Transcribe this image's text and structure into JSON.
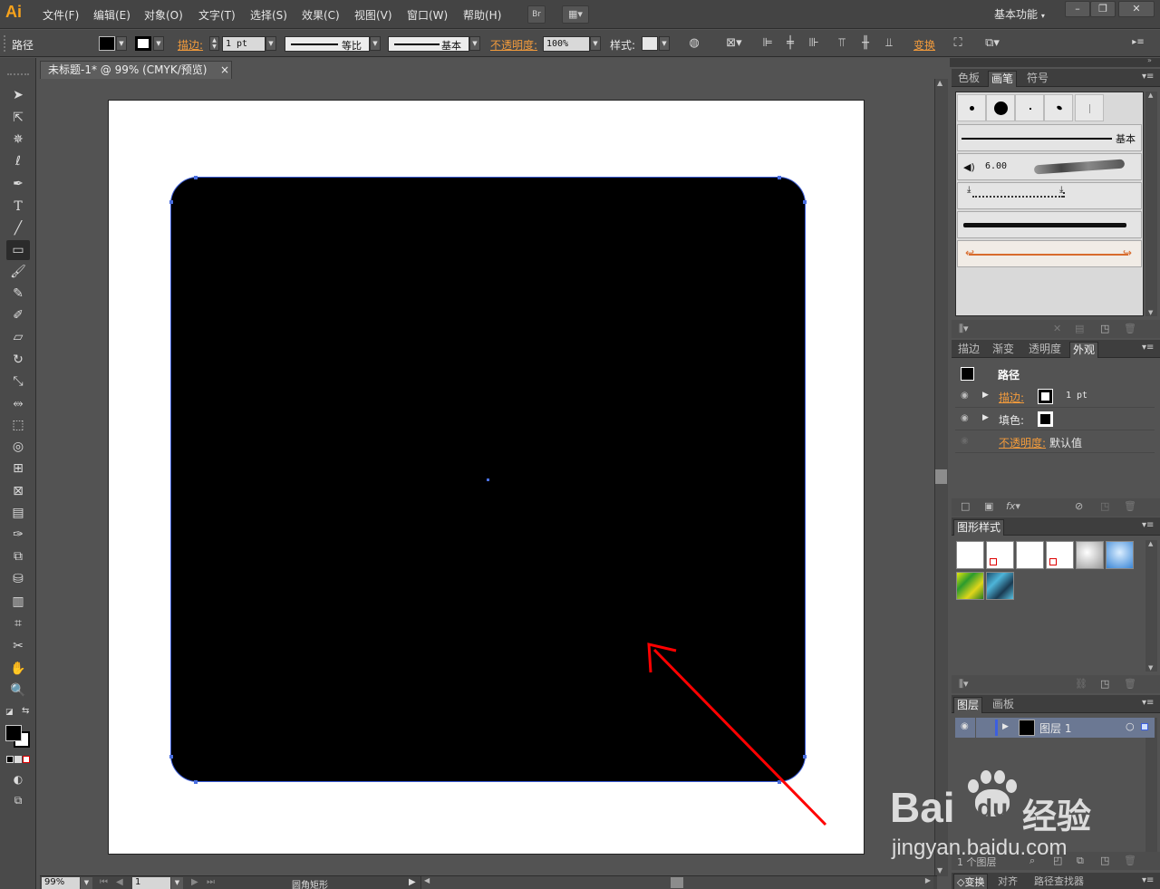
{
  "app": {
    "logo": "Ai",
    "menu": [
      "文件(F)",
      "编辑(E)",
      "对象(O)",
      "文字(T)",
      "选择(S)",
      "效果(C)",
      "视图(V)",
      "窗口(W)",
      "帮助(H)"
    ],
    "bridge_label": "Br",
    "workspace": "基本功能",
    "window_controls": [
      "–",
      "❐",
      "✕"
    ]
  },
  "control": {
    "object_type": "路径",
    "stroke_label": "描边:",
    "stroke_weight": "1 pt",
    "variable_width": "等比",
    "brush_def": "基本",
    "opacity_label": "不透明度:",
    "opacity_value": "100%",
    "style_label": "样式:",
    "transform_label": "变换"
  },
  "document": {
    "tab_title": "未标题-1* @ 99% (CMYK/预览)",
    "tab_close": "×",
    "fill_color": "#000000",
    "path_color": "#3b5cd6",
    "annotation_color": "#ff0000"
  },
  "status": {
    "zoom": "99%",
    "artboard_num": "1",
    "current_tool": "圆角矩形"
  },
  "panels": {
    "brush_group": {
      "tabs": [
        "色板",
        "画笔",
        "符号"
      ],
      "active": "画笔",
      "basic_label": "基本",
      "size_value": "6.00"
    },
    "appearance_group": {
      "tabs": [
        "描边",
        "渐变",
        "透明度",
        "外观"
      ],
      "active": "外观",
      "title": "路径",
      "rows": [
        {
          "label": "描边:",
          "value": "1 pt"
        },
        {
          "label": "填色:",
          "value": ""
        },
        {
          "label": "不透明度:",
          "value": "默认值"
        }
      ]
    },
    "graphic_styles": {
      "tabs": [
        "图形样式"
      ]
    },
    "layers": {
      "tabs": [
        "图层",
        "画板"
      ],
      "active": "图层",
      "layer_name": "图层 1",
      "footer": "1 个图层"
    },
    "bottom_tabs": [
      "变换",
      "对齐",
      "路径查找器"
    ]
  },
  "watermark": {
    "brand_a": "Bai",
    "brand_b": "du",
    "brand_c": "经验",
    "url": "jingyan.baidu.com"
  }
}
